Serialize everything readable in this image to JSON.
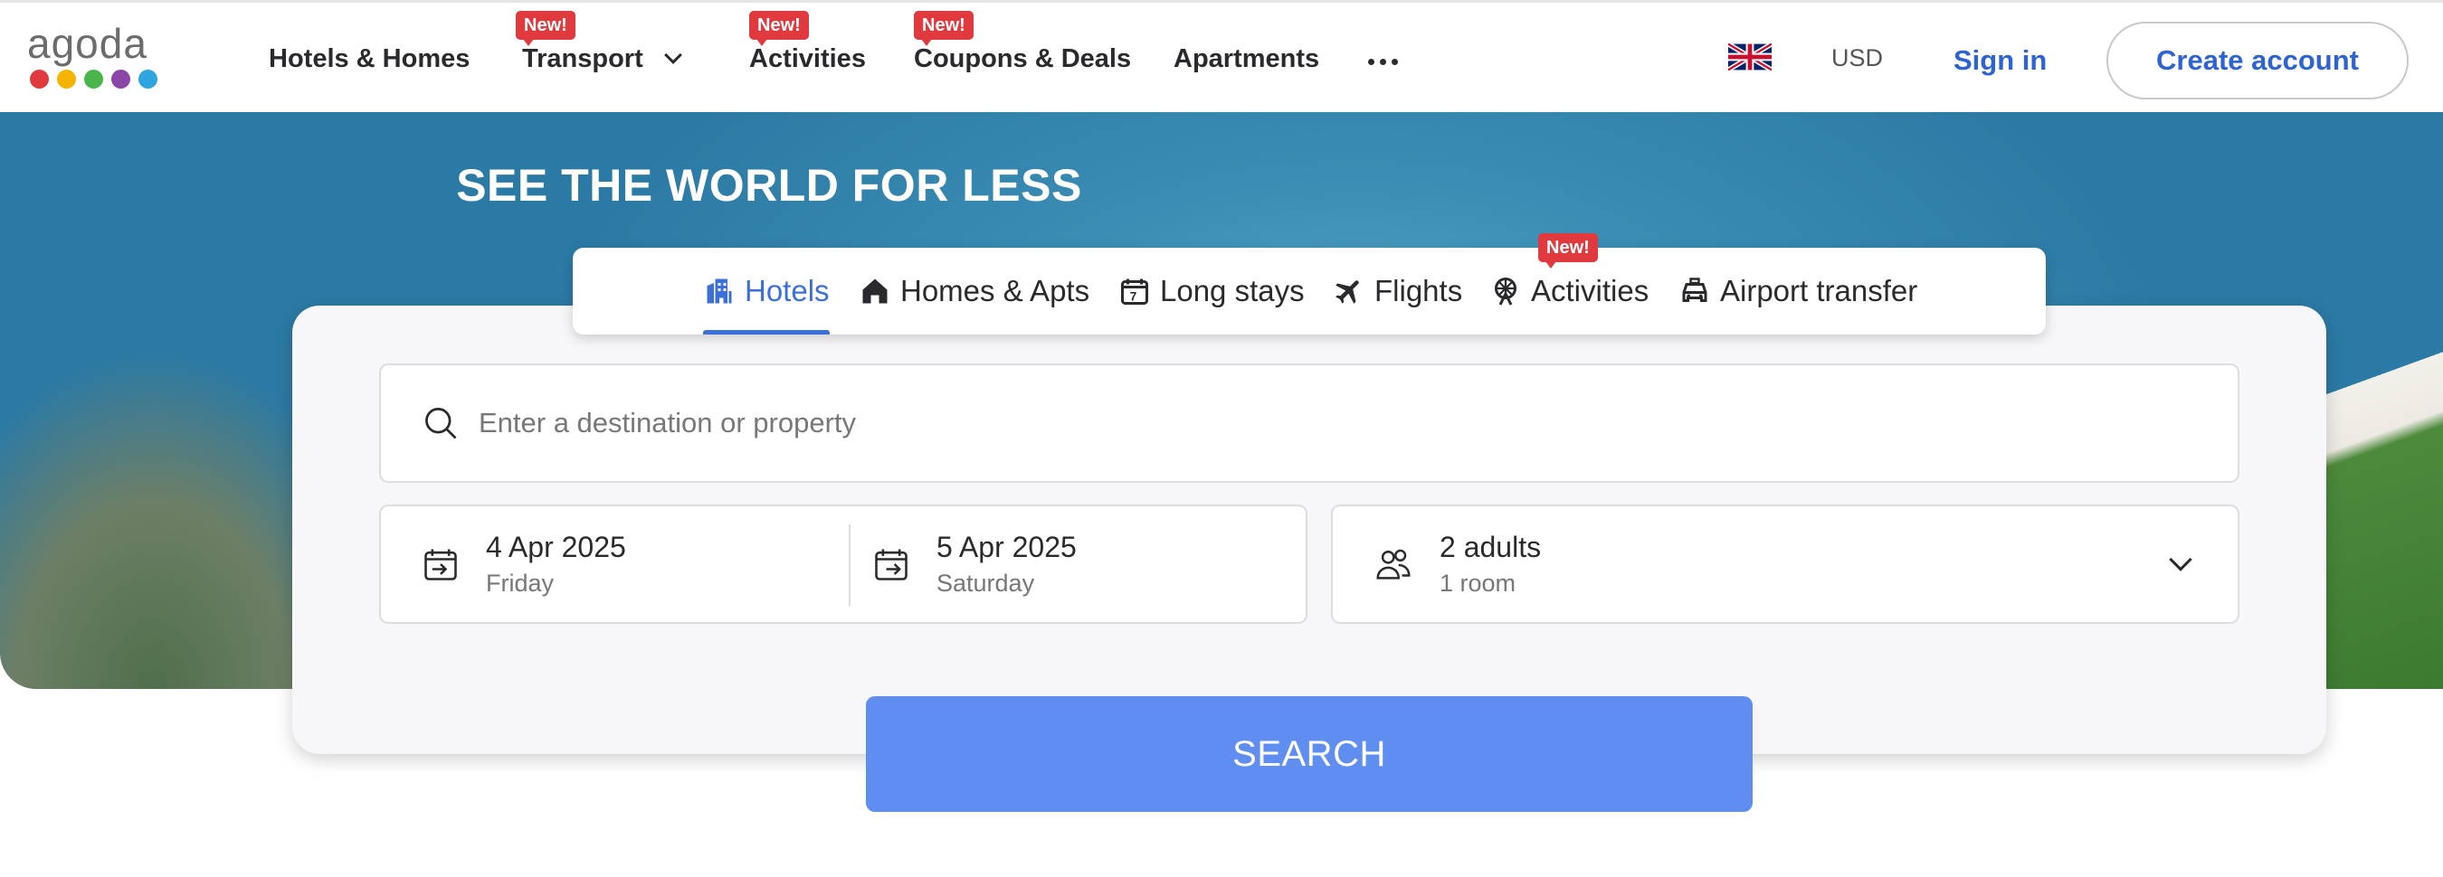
{
  "logo": {
    "text": "agoda",
    "dot_colors": [
      "#e0393e",
      "#f4b400",
      "#49b54b",
      "#8b47a8",
      "#2fa5e0"
    ]
  },
  "nav": {
    "items": [
      {
        "label": "Hotels & Homes",
        "badge": ""
      },
      {
        "label": "Transport",
        "badge": "New!"
      },
      {
        "label": "Activities",
        "badge": "New!"
      },
      {
        "label": "Coupons & Deals",
        "badge": "New!"
      },
      {
        "label": "Apartments",
        "badge": ""
      }
    ],
    "more_icon": "ellipsis-icon",
    "currency": "USD",
    "sign_in": "Sign in",
    "create_account": "Create account"
  },
  "hero": {
    "title": "SEE THE WORLD FOR LESS"
  },
  "tabs": [
    {
      "label": "Hotels",
      "icon": "hotel-icon",
      "active": true
    },
    {
      "label": "Homes & Apts",
      "icon": "home-icon",
      "active": false
    },
    {
      "label": "Long stays",
      "icon": "calendar-7-icon",
      "active": false
    },
    {
      "label": "Flights",
      "icon": "plane-icon",
      "active": false
    },
    {
      "label": "Activities",
      "icon": "ferris-wheel-icon",
      "active": false,
      "badge": "New!"
    },
    {
      "label": "Airport transfer",
      "icon": "car-icon",
      "active": false
    }
  ],
  "search": {
    "destination_placeholder": "Enter a destination or property",
    "checkin": {
      "date": "4 Apr 2025",
      "day": "Friday"
    },
    "checkout": {
      "date": "5 Apr 2025",
      "day": "Saturday"
    },
    "guests": {
      "main": "2 adults",
      "sub": "1 room"
    },
    "button": "SEARCH"
  },
  "colors": {
    "brand_blue": "#2e64d1",
    "tab_active": "#3b70d9",
    "search_button": "#5f8ef0",
    "badge_red": "#e0393e"
  }
}
